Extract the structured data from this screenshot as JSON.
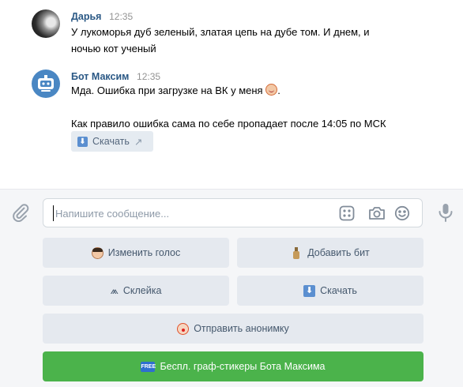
{
  "messages": [
    {
      "author": "Дарья",
      "time": "12:35",
      "line1": "У лукоморья дуб зеленый, златая цепь на дубе том. И днем, и",
      "line2": "ночью кот ученый"
    },
    {
      "author": "Бот Максим",
      "time": "12:35",
      "line1": "Мда. Ошибка при загрузке на ВК у меня",
      "line1_end": ".",
      "line2": "Как правило ошибка сама по себе пропадает после 14:05 по МСК",
      "attachment_label": "Скачать",
      "attachment_arrow": "↗"
    }
  ],
  "composer": {
    "placeholder": "Напишите сообщение..."
  },
  "keyboard": {
    "change_voice": "Изменить голос",
    "add_beat": "Добавить бит",
    "glue": "Склейка",
    "download": "Скачать",
    "send_anonymous": "Отправить анонимку",
    "free_stickers": "Беспл. граф-стикеры Бота Максима",
    "free_badge": "FREE",
    "glue_icon_glyph": "⩕"
  },
  "colors": {
    "author_link": "#2a5885",
    "keyboard_button": "#e5e9ef",
    "primary_green": "#4bb34b",
    "time_gray": "#939393"
  },
  "icons": [
    "paperclip-icon",
    "apps-grid-icon",
    "camera-icon",
    "smile-icon",
    "microphone-icon",
    "download-icon",
    "bot-avatar-icon"
  ]
}
